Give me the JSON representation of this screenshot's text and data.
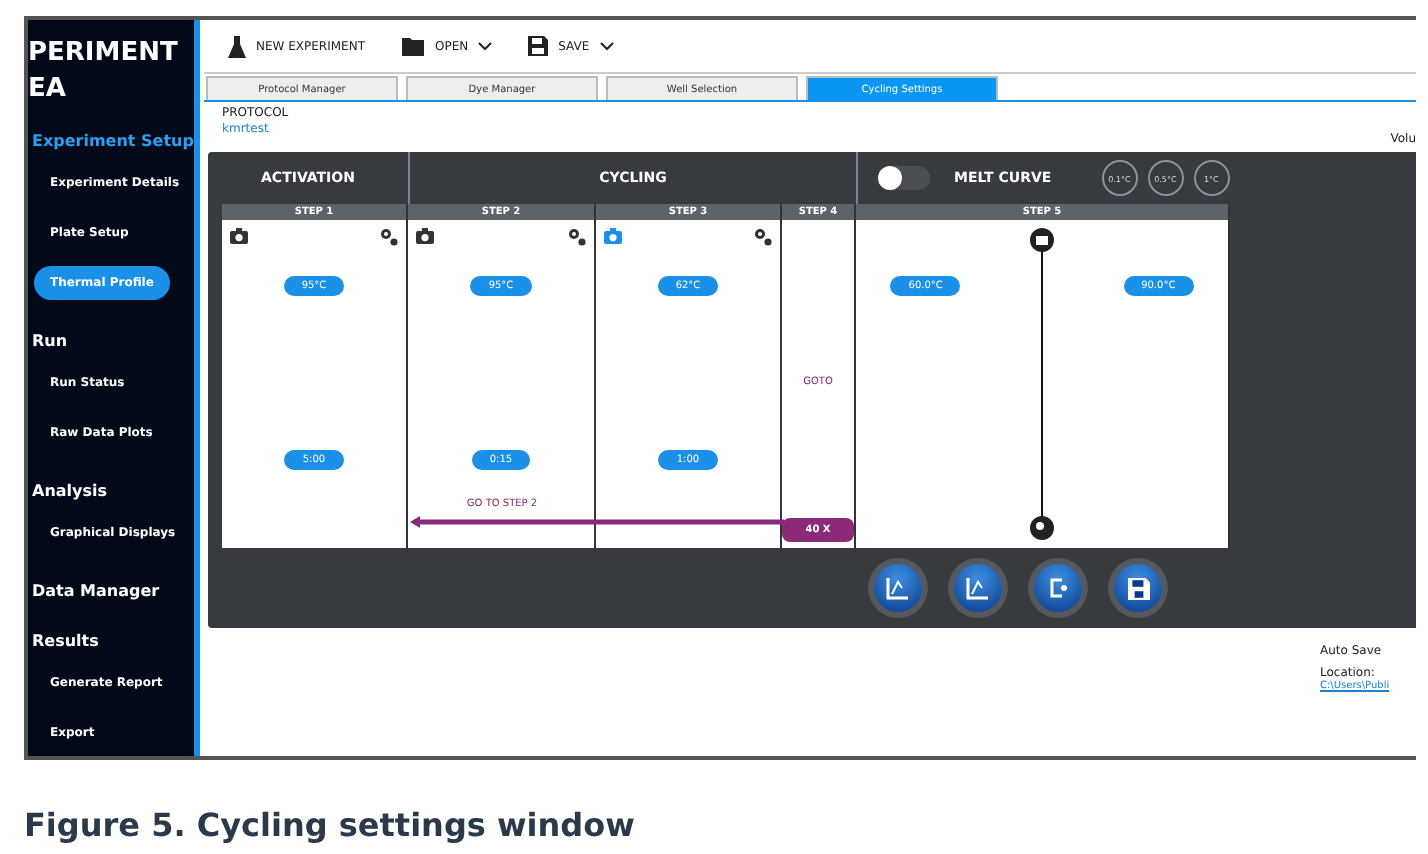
{
  "sidebar": {
    "title_lines": [
      "PERIMENT",
      "EA"
    ],
    "sections": [
      {
        "heading": "Experiment Setup",
        "accent": true,
        "items": [
          {
            "label": "Experiment Details",
            "selected": false
          },
          {
            "label": "Plate Setup",
            "selected": false
          },
          {
            "label": "Thermal Profile",
            "selected": true
          }
        ]
      },
      {
        "heading": "Run",
        "accent": false,
        "items": [
          {
            "label": "Run Status",
            "selected": false
          },
          {
            "label": "Raw Data Plots",
            "selected": false
          }
        ]
      },
      {
        "heading": "Analysis",
        "accent": false,
        "items": [
          {
            "label": "Graphical Displays",
            "selected": false
          }
        ]
      },
      {
        "heading": "Data Manager",
        "accent": false
      },
      {
        "heading": "Results",
        "accent": false,
        "items": [
          {
            "label": "Generate Report",
            "selected": false
          },
          {
            "label": "Export",
            "selected": false
          }
        ]
      }
    ]
  },
  "toolbar": [
    {
      "label": "NEW EXPERIMENT",
      "kind": "flask",
      "dropdown": false
    },
    {
      "label": "OPEN",
      "kind": "folder",
      "dropdown": true
    },
    {
      "label": "SAVE",
      "kind": "save",
      "dropdown": true
    }
  ],
  "tabs": [
    {
      "label": "Protocol Manager",
      "selected": false
    },
    {
      "label": "Dye Manager",
      "selected": false
    },
    {
      "label": "Well Selection",
      "selected": false
    },
    {
      "label": "Cycling Settings",
      "selected": true
    }
  ],
  "protocol": {
    "label": "PROTOCOL",
    "name": "kmrtest",
    "volume_label": "Volu"
  },
  "stages": [
    "ACTIVATION",
    "CYCLING"
  ],
  "melt_curve": {
    "label": "MELT CURVE",
    "on": false,
    "options": [
      "0.1°C",
      "0.5°C",
      "1°C"
    ]
  },
  "steps": [
    {
      "kind": "normal",
      "label": "STEP 1",
      "camera_on": false,
      "temp": "95°C",
      "time": "5:00"
    },
    {
      "kind": "normal",
      "label": "STEP 2",
      "camera_on": false,
      "temp": "95°C",
      "time": "0:15"
    },
    {
      "kind": "normal",
      "label": "STEP 3",
      "camera_on": true,
      "temp": "62°C",
      "time": "1:00"
    },
    {
      "kind": "goto",
      "label": "STEP 4",
      "goto": "GOTO",
      "count": "40 X"
    },
    {
      "kind": "melt",
      "label": "STEP 5",
      "temps": [
        "60.0°C",
        "90.0°C"
      ]
    }
  ],
  "loop_label": "GO TO STEP 2",
  "actions": [
    {
      "kind": "graph"
    },
    {
      "kind": "graph"
    },
    {
      "kind": "goto"
    },
    {
      "kind": "save"
    }
  ],
  "auto_save": {
    "label": "Auto Save",
    "location_label": "Location:",
    "path": "C:\\Users\\Publi"
  },
  "caption": "Figure 5. Cycling settings window"
}
